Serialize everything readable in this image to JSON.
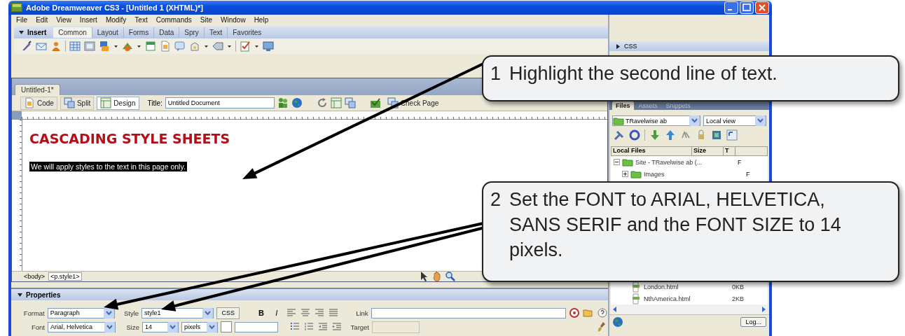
{
  "window": {
    "title": "Adobe Dreamweaver CS3 - [Untitled 1 (XHTML)*]"
  },
  "menu": [
    "File",
    "Edit",
    "View",
    "Insert",
    "Modify",
    "Text",
    "Commands",
    "Site",
    "Window",
    "Help"
  ],
  "insert_bar": {
    "title": "Insert",
    "expanded": true,
    "tabs": [
      {
        "label": "Common",
        "selected": true
      },
      {
        "label": "Layout",
        "selected": false
      },
      {
        "label": "Forms",
        "selected": false
      },
      {
        "label": "Data",
        "selected": false
      },
      {
        "label": "Spry",
        "selected": false
      },
      {
        "label": "Text",
        "selected": false
      },
      {
        "label": "Favorites",
        "selected": false
      }
    ]
  },
  "document": {
    "tab": "Untitled-1*",
    "view_buttons": [
      {
        "label": "Code",
        "selected": false
      },
      {
        "label": "Split",
        "selected": false
      },
      {
        "label": "Design",
        "selected": true
      }
    ],
    "title_label": "Title:",
    "title_value": "Untitled Document",
    "check_page": "Check Page",
    "heading": "CASCADING STYLE SHEETS",
    "paragraph": {
      "text": "We will apply styles to the text in this page only.",
      "selected": true
    },
    "tag_selector": [
      "<body>",
      "<p.style1>"
    ]
  },
  "properties": {
    "title": "Properties",
    "expanded": true,
    "format_label": "Format",
    "format": "Paragraph",
    "style_label": "Style",
    "style": "style1",
    "css_button": "CSS",
    "bold_button": "B",
    "italic_button": "I",
    "link_label": "Link",
    "font_label": "Font",
    "font": "Arial, Helvetica",
    "size_label": "Size",
    "size": "14",
    "unit": "pixels",
    "target_label": "Target"
  },
  "css_panel": {
    "title": "CSS",
    "expanded": false
  },
  "files_panel": {
    "tabs": [
      {
        "label": "Files",
        "selected": true
      },
      {
        "label": "Assets",
        "selected": false
      },
      {
        "label": "Snippets",
        "selected": false
      }
    ],
    "site": "TRavelwise ab",
    "view": "Local view",
    "columns": [
      "Local Files",
      "Size",
      "T"
    ],
    "tree": [
      {
        "kind": "folder",
        "name": "Site - TRavelwise ab (...",
        "type": "F",
        "expanded": true,
        "children": [
          {
            "kind": "folder",
            "name": "Images",
            "type": "F",
            "expanded": false
          },
          {
            "kind": "file",
            "name": "London.html",
            "size": "0KB"
          },
          {
            "kind": "file",
            "name": "NthAmerica.html",
            "size": "2KB"
          }
        ]
      }
    ],
    "log_button": "Log..."
  },
  "callouts": [
    {
      "number": "1",
      "text": "Highlight the second line of text."
    },
    {
      "number": "2",
      "text": "Set the FONT to ARIAL, HELVETICA, SANS SERIF and the FONT SIZE to 14 pixels."
    }
  ]
}
